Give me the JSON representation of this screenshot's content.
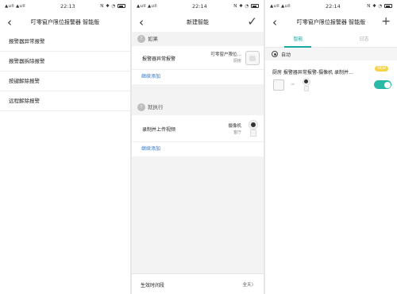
{
  "status_bars": [
    {
      "signal": "▲ull ▲ull",
      "time": "22:13",
      "icons": "N ✱ ◔"
    },
    {
      "signal": "▲ull ▲ull",
      "time": "22:14",
      "icons": "N ✱ ◔"
    },
    {
      "signal": "▲ull ▲ull",
      "time": "22:14",
      "icons": "N ✱ ◔"
    }
  ],
  "screen1": {
    "title": "叮零窗户限位报警器 智能版",
    "items": [
      "报警器异常报警",
      "报警器拆除报警",
      "按键解除报警",
      "远程解除报警"
    ]
  },
  "screen2": {
    "title": "新建智能",
    "if_label": "如果",
    "if_icon": "?",
    "then_label": "就执行",
    "then_icon": "!",
    "condition": {
      "label": "报警器异常报警",
      "device": "叮零窗户限位…",
      "room": "厨房"
    },
    "action": {
      "label": "录制并上传视频",
      "device": "摄像机",
      "room": "客厅"
    },
    "add_more": "继续添加",
    "effective_time": {
      "label": "生效时间段",
      "value": "全天〉"
    }
  },
  "screen3": {
    "title": "叮零窗户限位报警器 智能版",
    "tabs": [
      "智能",
      "日志"
    ],
    "auto_label": "自动",
    "scene": {
      "title": "厨房 报警器异常报警-摄像机 录制并…",
      "badge": "NEW",
      "link": "∞",
      "enabled": true
    },
    "add_icon": "plus-icon"
  },
  "colors": {
    "accent": "#19a9a0",
    "link": "#2a74c9",
    "toggle": "#2ab9a6",
    "badge": "#f7d34a"
  }
}
